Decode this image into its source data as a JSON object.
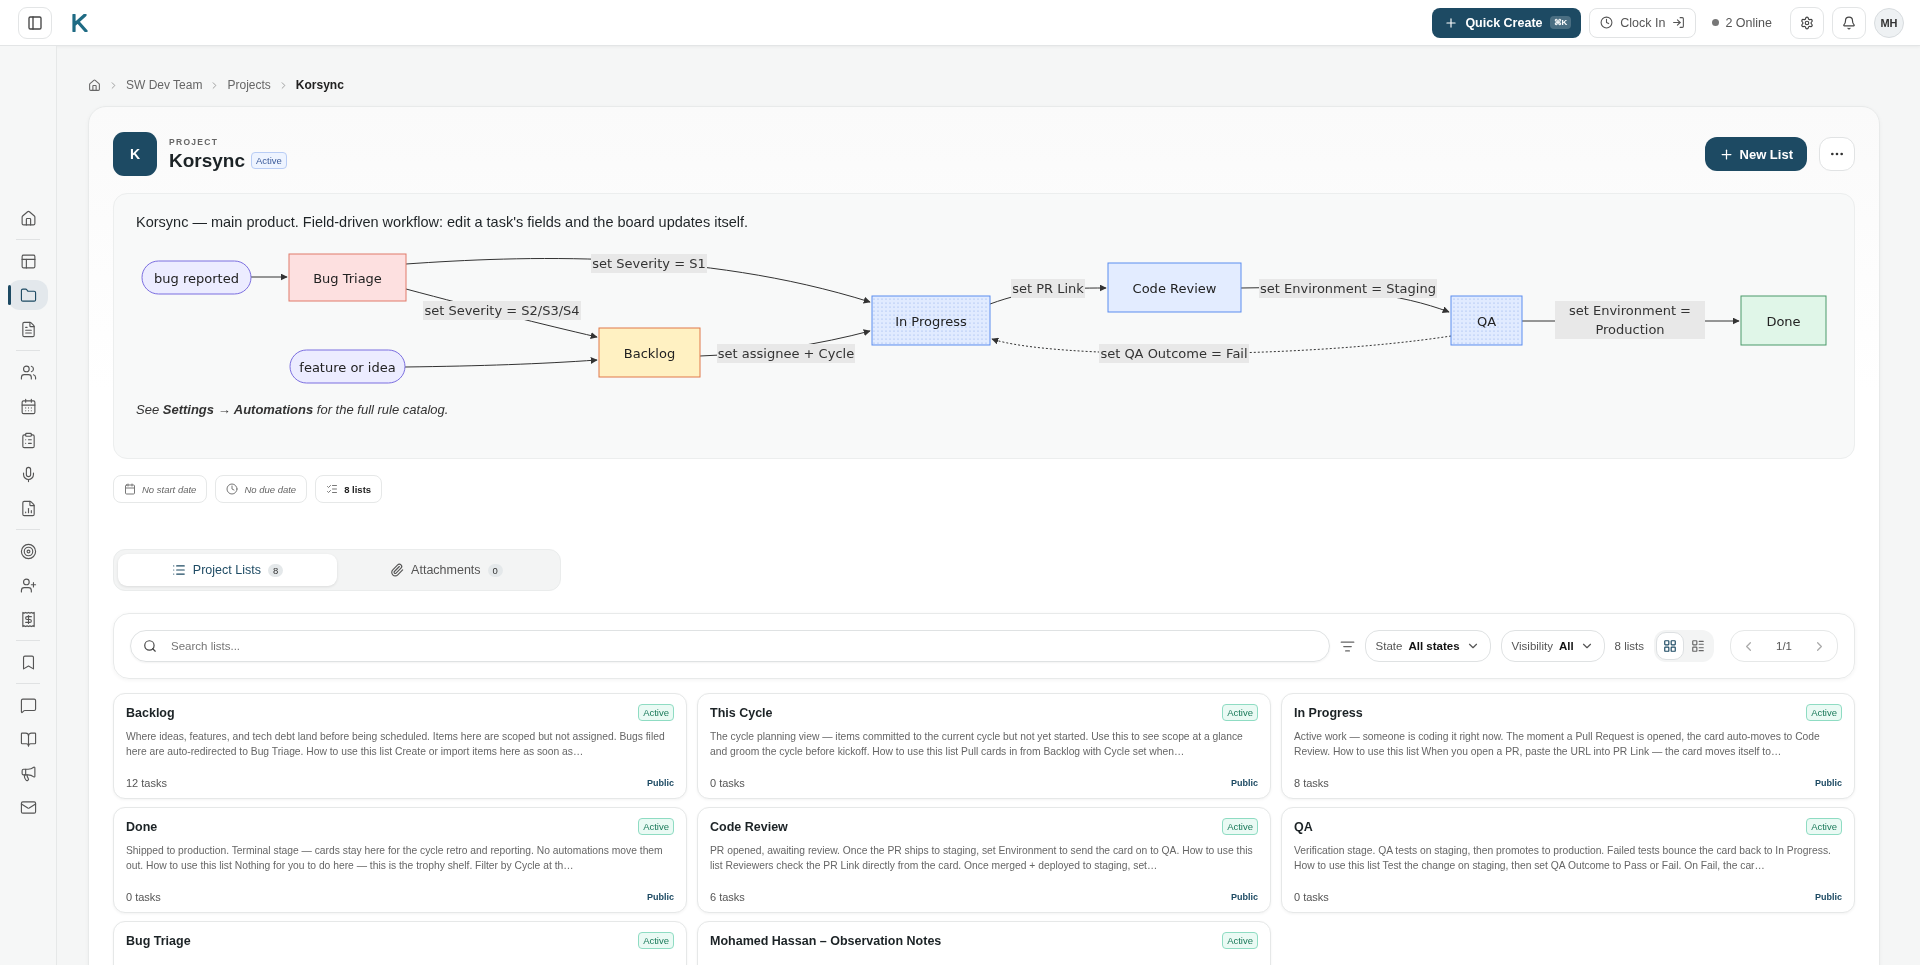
{
  "topbar": {
    "quick_create": {
      "label": "Quick Create",
      "shortcut": "⌘K"
    },
    "clock_in": "Clock In",
    "online": "2 Online",
    "avatar": "MH"
  },
  "sidebar": {
    "groups": [
      [
        {
          "selected": false
        }
      ],
      [
        {
          "selected": false
        },
        {
          "selected": true
        },
        {
          "selected": false
        }
      ],
      [
        {
          "selected": false
        },
        {
          "selected": false
        },
        {
          "selected": false
        },
        {
          "selected": false
        },
        {
          "selected": false
        }
      ],
      [
        {
          "selected": false
        },
        {
          "selected": false
        },
        {
          "selected": false
        }
      ],
      [
        {
          "selected": false
        }
      ],
      [
        {
          "selected": false
        },
        {
          "selected": false
        },
        {
          "selected": false
        },
        {
          "selected": false
        }
      ]
    ]
  },
  "breadcrumb": [
    "SW Dev Team",
    "Projects",
    "Korsync"
  ],
  "project": {
    "eyebrow": "PROJECT",
    "avatar": "K",
    "name": "Korsync",
    "status": "Active",
    "new_list": "New List"
  },
  "description": {
    "title": "Korsync — main product. Field-driven workflow: edit a task's fields and the board updates itself.",
    "diagram": {
      "nodes": [
        {
          "label": "bug reported",
          "kind": "terminal",
          "color": "#ececff",
          "hatched": false
        },
        {
          "label": "Bug Triage",
          "kind": "step",
          "color": "#fde0e0",
          "hatched": false
        },
        {
          "label": "feature or idea",
          "kind": "terminal",
          "color": "#ececff",
          "hatched": false
        },
        {
          "label": "Backlog",
          "kind": "step",
          "color": "#fff1c2",
          "hatched": false
        },
        {
          "label": "In Progress",
          "kind": "step",
          "color": "#e1ebff",
          "hatched": true
        },
        {
          "label": "Code Review",
          "kind": "step",
          "color": "#e3ecff",
          "hatched": false
        },
        {
          "label": "QA",
          "kind": "step",
          "color": "#e1ebff",
          "hatched": true
        },
        {
          "label": "Done",
          "kind": "step",
          "color": "#e0f6e8",
          "hatched": false
        }
      ],
      "edges": [
        {
          "kind": "forward"
        },
        {
          "kind": "forward",
          "label": "set Severity = S1"
        },
        {
          "kind": "forward",
          "label": "set Severity = S2/S3/S4"
        },
        {
          "kind": "forward"
        },
        {
          "kind": "forward",
          "label": "set assignee + Cycle"
        },
        {
          "kind": "forward",
          "label": "set PR Link"
        },
        {
          "kind": "forward",
          "label": "set Environment = Staging"
        },
        {
          "kind": "forward",
          "label": "set Environment = Production"
        },
        {
          "kind": "return",
          "label": "set QA Outcome = Fail"
        }
      ]
    },
    "footer": "See **Settings → Automations** for the full rule catalog."
  },
  "meta": [
    {
      "kind": "start",
      "label": "No start date"
    },
    {
      "kind": "due",
      "label": "No due date"
    },
    {
      "kind": "lists",
      "label": "8 lists"
    }
  ],
  "tabs": [
    {
      "label": "Project Lists",
      "count": "8",
      "selected": true
    },
    {
      "label": "Attachments",
      "count": "0",
      "selected": false
    }
  ],
  "filters": {
    "search_placeholder": "Search lists...",
    "state": {
      "label": "State",
      "value": "All states"
    },
    "visibility": {
      "label": "Visibility",
      "value": "All"
    },
    "count": "8 lists",
    "views": [
      {
        "kind": "grid",
        "selected": true
      },
      {
        "kind": "list",
        "selected": false
      }
    ],
    "page": "1/1"
  },
  "lists": [
    {
      "title": "Backlog",
      "status": "Active",
      "description": "Where ideas, features, and tech debt land before being scheduled. Items here are scoped but not assigned. Bugs filed here are auto-redirected to Bug Triage. How to use this list Create or import items here as soon as…",
      "tasks": "12 tasks",
      "visibility": "Public"
    },
    {
      "title": "This Cycle",
      "status": "Active",
      "description": "The cycle planning view — items committed to the current cycle but not yet started. Use this to see scope at a glance and groom the cycle before kickoff. How to use this list Pull cards in from Backlog with Cycle set when…",
      "tasks": "0 tasks",
      "visibility": "Public"
    },
    {
      "title": "In Progress",
      "status": "Active",
      "description": "Active work — someone is coding it right now. The moment a Pull Request is opened, the card auto-moves to Code Review. How to use this list When you open a PR, paste the URL into PR Link — the card moves itself to…",
      "tasks": "8 tasks",
      "visibility": "Public"
    },
    {
      "title": "Done",
      "status": "Active",
      "description": "Shipped to production. Terminal stage — cards stay here for the cycle retro and reporting. No automations move them out. How to use this list Nothing for you to do here — this is the trophy shelf. Filter by Cycle at th…",
      "tasks": "0 tasks",
      "visibility": "Public"
    },
    {
      "title": "Code Review",
      "status": "Active",
      "description": "PR opened, awaiting review. Once the PR ships to staging, set Environment to send the card on to QA. How to use this list Reviewers check the PR Link directly from the card. Once merged + deployed to staging, set…",
      "tasks": "6 tasks",
      "visibility": "Public"
    },
    {
      "title": "QA",
      "status": "Active",
      "description": "Verification stage. QA tests on staging, then promotes to production. Failed tests bounce the card back to In Progress. How to use this list Test the change on staging, then set QA Outcome to Pass or Fail. On Fail, the car…",
      "tasks": "0 tasks",
      "visibility": "Public"
    },
    {
      "title": "Bug Triage",
      "status": "Active"
    },
    {
      "title": "Mohamed Hassan – Observation Notes",
      "status": "Active"
    }
  ]
}
